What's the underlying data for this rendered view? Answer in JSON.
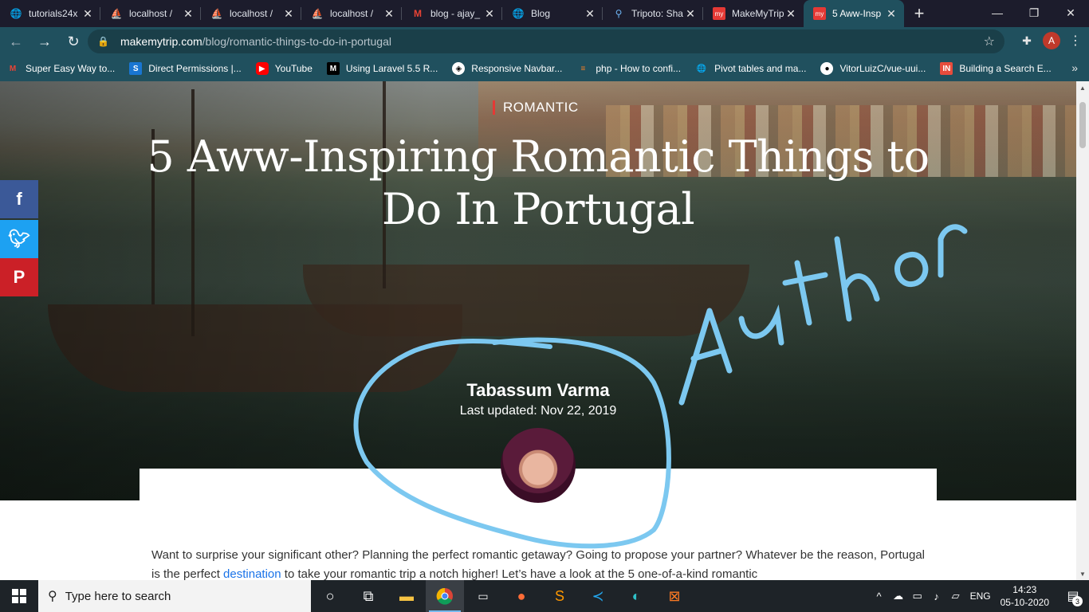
{
  "tabs": [
    {
      "label": "tutorials24x",
      "icon": "globe-icon",
      "active": false
    },
    {
      "label": "localhost /",
      "icon": "phpmyadmin-icon",
      "active": false
    },
    {
      "label": "localhost /",
      "icon": "phpmyadmin-icon",
      "active": false
    },
    {
      "label": "localhost /",
      "icon": "phpmyadmin-icon",
      "active": false
    },
    {
      "label": "blog - ajay_",
      "icon": "gmail-icon",
      "active": false
    },
    {
      "label": "Blog",
      "icon": "globe-icon",
      "active": false
    },
    {
      "label": "Tripoto: Sha",
      "icon": "location-pin-icon",
      "active": false
    },
    {
      "label": "MakeMyTrip",
      "icon": "makemytrip-icon",
      "active": false
    },
    {
      "label": "5 Aww-Insp",
      "icon": "makemytrip-icon",
      "active": true
    }
  ],
  "address_bar": {
    "domain": "makemytrip.com",
    "path": "/blog/romantic-things-to-do-in-portugal"
  },
  "profile_initial": "A",
  "bookmarks": [
    {
      "label": "Super Easy Way to...",
      "icon": "gmail-icon"
    },
    {
      "label": "Direct Permissions |...",
      "icon": "s-icon"
    },
    {
      "label": "YouTube",
      "icon": "youtube-icon"
    },
    {
      "label": "Using Laravel 5.5 R...",
      "icon": "medium-icon"
    },
    {
      "label": "Responsive Navbar...",
      "icon": "codepen-icon"
    },
    {
      "label": "php - How to confi...",
      "icon": "stackoverflow-icon"
    },
    {
      "label": "Pivot tables and ma...",
      "icon": "globe-icon"
    },
    {
      "label": "VitorLuizC/vue-uui...",
      "icon": "github-icon"
    },
    {
      "label": "Building a Search E...",
      "icon": "in-icon"
    }
  ],
  "article": {
    "category": "ROMANTIC",
    "title": "5 Aww-Inspiring Romantic Things to Do In Portugal",
    "author": "Tabassum Varma",
    "updated": "Last updated: Nov 22, 2019",
    "body_1": "Want to surprise your significant other? Planning the perfect romantic getaway? Going to propose your partner? Whatever be the reason,",
    "body_2_start": "Portugal is the perfect ",
    "body_2_link": "destination",
    "body_2_end": " to take your romantic trip a notch higher! Let’s have a look at the 5 one-of-a-kind romantic"
  },
  "annotation_text": "Author",
  "share": [
    "facebook-icon",
    "twitter-icon",
    "pinterest-icon"
  ],
  "taskbar": {
    "search_placeholder": "Type here to search",
    "apps": [
      "cortana-icon",
      "task-view-icon",
      "file-explorer-icon",
      "chrome-icon",
      "terminal-icon",
      "postman-icon",
      "sublime-text-icon",
      "vscode-icon",
      "edge-icon",
      "xampp-icon"
    ],
    "language": "ENG",
    "time": "14:23",
    "date": "05-10-2020",
    "notifications": "3"
  },
  "colors": {
    "tab_strip": "#1c1c2c",
    "toolbar": "#20505e",
    "accent_red": "#e53935",
    "annotation": "#7cc8f0"
  }
}
